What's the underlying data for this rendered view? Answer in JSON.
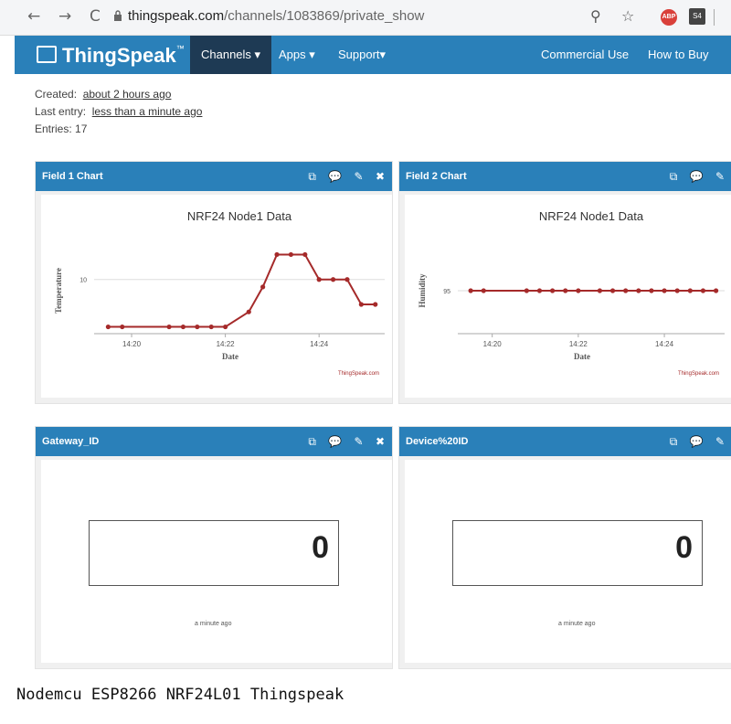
{
  "browser": {
    "url_host": "thingspeak.com",
    "url_path": "/channels/1083869/private_show",
    "back_icon": "←",
    "forward_icon": "→",
    "reload_icon": "C",
    "zoom_icon": "⚲",
    "star_icon": "☆",
    "ext1_label": "ABP",
    "ext2_label": "S4"
  },
  "navbar": {
    "brand": "ThingSpeak",
    "trademark": "™",
    "items": [
      {
        "label": "Channels ▾"
      },
      {
        "label": "Apps ▾"
      },
      {
        "label": "Support▾"
      },
      {
        "label": "Commercial Use"
      },
      {
        "label": "How to Buy"
      }
    ]
  },
  "channel_meta": {
    "created_label": "Created:",
    "created_value": "about 2 hours ago",
    "last_entry_label": "Last entry:",
    "last_entry_value": "less than a minute ago",
    "entries_label": "Entries:",
    "entries_value": "17"
  },
  "panel_tools": {
    "edit": "⧉",
    "comment": "💬",
    "pencil": "✎",
    "close": "✖"
  },
  "panels": {
    "field1": {
      "title": "Field 1 Chart"
    },
    "field2": {
      "title": "Field 2 Chart"
    },
    "gateway": {
      "title": "Gateway_ID",
      "value": "0",
      "ago": "a minute ago"
    },
    "device": {
      "title": "Device%20ID",
      "value": "0",
      "ago": "a minute ago"
    }
  },
  "chart_data": [
    {
      "type": "line",
      "title": "NRF24 Node1 Data",
      "xlabel": "Date",
      "ylabel": "Temperature",
      "x_ticks": [
        "14:20",
        "14:22",
        "14:24"
      ],
      "y_ticks": [
        10
      ],
      "credit": "ThingSpeak.com",
      "color": "#a52a2a",
      "points_x": [
        0,
        0.3,
        1.3,
        1.6,
        1.9,
        2.2,
        2.5,
        3.0,
        3.3,
        3.6,
        3.9,
        4.2,
        4.5,
        4.8,
        5.1,
        5.4,
        5.7
      ],
      "points_y": [
        8.1,
        8.1,
        8.1,
        8.1,
        8.1,
        8.1,
        8.1,
        8.7,
        9.7,
        11.0,
        11.0,
        11.0,
        10.0,
        10.0,
        10.0,
        9.0,
        9.0
      ],
      "x_tick_positions": [
        0.5,
        2.5,
        4.5
      ],
      "xlim": [
        -0.3,
        5.9
      ],
      "ylim": [
        7.9,
        11.2
      ]
    },
    {
      "type": "line",
      "title": "NRF24 Node1 Data",
      "xlabel": "Date",
      "ylabel": "Humidity",
      "x_ticks": [
        "14:20",
        "14:22",
        "14:24"
      ],
      "y_ticks": [
        95
      ],
      "credit": "ThingSpeak.com",
      "color": "#a52a2a",
      "points_x": [
        0,
        0.3,
        1.3,
        1.6,
        1.9,
        2.2,
        2.5,
        3.0,
        3.3,
        3.6,
        3.9,
        4.2,
        4.5,
        4.8,
        5.1,
        5.4,
        5.7
      ],
      "points_y": [
        95,
        95,
        95,
        95,
        95,
        95,
        95,
        95,
        95,
        95,
        95,
        95,
        95,
        95,
        95,
        95,
        95
      ],
      "x_tick_positions": [
        0.5,
        2.5,
        4.5
      ],
      "xlim": [
        -0.3,
        5.9
      ],
      "ylim": [
        93,
        97
      ]
    }
  ],
  "caption": "Nodemcu ESP8266 NRF24L01 Thingspeak"
}
